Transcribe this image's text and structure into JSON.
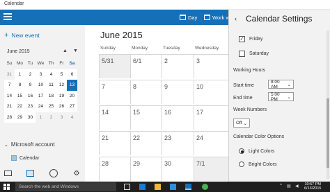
{
  "window": {
    "title": "Calendar"
  },
  "toolbar": {
    "day_label": "Day",
    "week_label": "Work w"
  },
  "sidebar": {
    "new_event": "New event",
    "mini_calendar": {
      "month_label": "June 2015",
      "weekday_headers": [
        "Su",
        "Mo",
        "Tu",
        "We",
        "Th",
        "Fr",
        "Sa"
      ],
      "days": [
        "31",
        "1",
        "2",
        "3",
        "4",
        "5",
        "6",
        "7",
        "8",
        "9",
        "10",
        "11",
        "12",
        "13",
        "14",
        "15",
        "16",
        "17",
        "18",
        "19",
        "20",
        "21",
        "22",
        "23",
        "24",
        "25",
        "26",
        "27",
        "28",
        "29",
        "30",
        "1",
        "2",
        "3",
        "4"
      ],
      "selected_day": "13"
    },
    "account": "Microsoft account",
    "calendar_item": "Calendar"
  },
  "main": {
    "month_title": "June 2015",
    "weekdays": [
      "Sunday",
      "Monday",
      "Tuesday",
      "Wednesday"
    ],
    "rows": [
      [
        "5/31",
        "6/1",
        "2",
        "3"
      ],
      [
        "7",
        "8",
        "9",
        "10"
      ],
      [
        "14",
        "15",
        "16",
        "17"
      ],
      [
        "21",
        "22",
        "23",
        "24"
      ],
      [
        "28",
        "29",
        "30",
        "7/1"
      ]
    ]
  },
  "settings": {
    "title": "Calendar Settings",
    "friday_label": "Friday",
    "friday_mark": "✓",
    "saturday_label": "Saturday",
    "working_hours_heading": "Working Hours",
    "start_time_label": "Start time",
    "start_time_value": "8:00 AM",
    "end_time_label": "End time",
    "end_time_value": "5:00 PM",
    "week_numbers_heading": "Week Numbers",
    "week_numbers_value": "Off",
    "color_heading": "Calendar Color Options",
    "light_colors_label": "Light Colors",
    "bright_colors_label": "Bright Colors",
    "color_selected": "Light Colors",
    "dropdown_chevron": "⌄"
  },
  "taskbar": {
    "search_placeholder": "Search the web and Windows",
    "time": "10:57 PM",
    "date": "6/13/2015"
  },
  "colors": {
    "accent": "#1570b8",
    "sidebar_bg": "#f2f2f2",
    "taskbar_bg": "#1f1f1f"
  }
}
